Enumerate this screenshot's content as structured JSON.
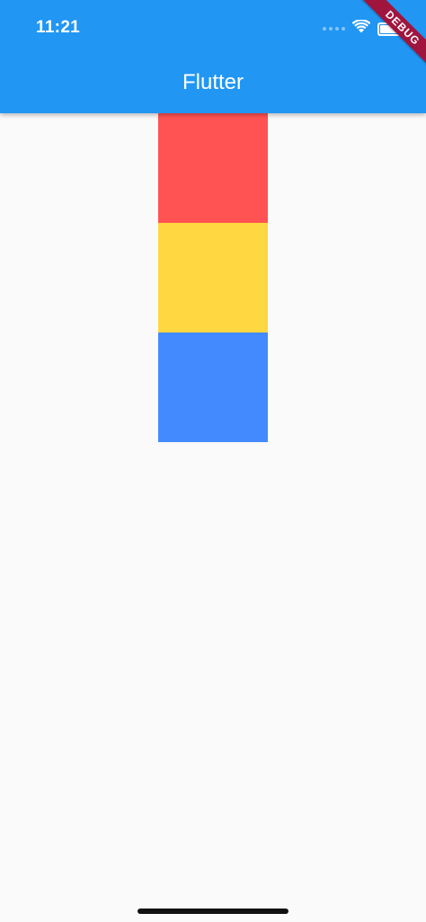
{
  "status_bar": {
    "time": "11:21",
    "icons": [
      "signal-dots-icon",
      "wifi-icon",
      "battery-icon"
    ],
    "battery_level": 1.0
  },
  "app_bar": {
    "title": "Flutter",
    "color": "#2196F3"
  },
  "debug_banner": {
    "label": "DEBUG",
    "color": "#A0153E"
  },
  "body": {
    "background": "#FAFAFA",
    "blocks": [
      {
        "name": "red-block",
        "color": "#FF5252"
      },
      {
        "name": "yellow-block",
        "color": "#FFD740"
      },
      {
        "name": "blue-block",
        "color": "#448AFF"
      }
    ]
  },
  "home_indicator": {
    "color": "#111111"
  }
}
